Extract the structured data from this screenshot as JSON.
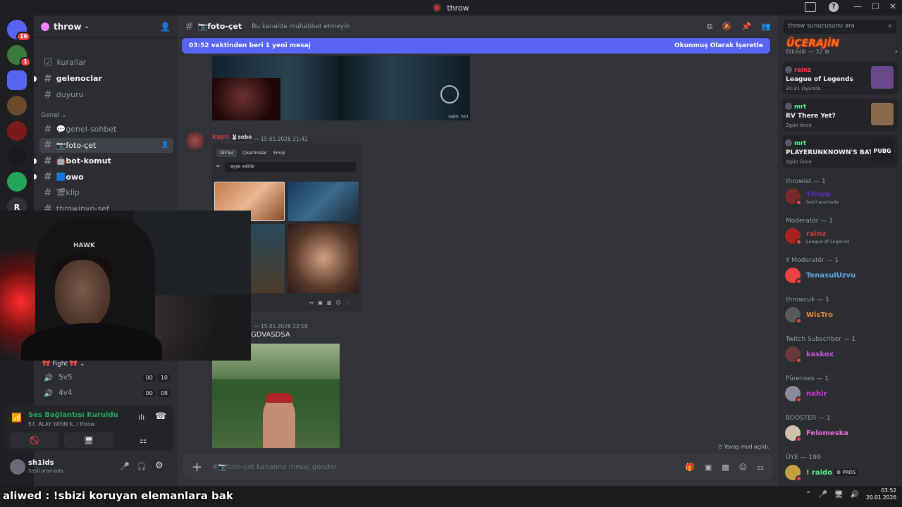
{
  "window": {
    "title": "throw"
  },
  "servers": [
    {
      "label": "",
      "badge": "16",
      "color": "#5865f2"
    },
    {
      "label": "",
      "badge": "1",
      "color": "#3a7a3a"
    },
    {
      "label": "",
      "badge": "",
      "color": "#5865f2"
    },
    {
      "label": "",
      "badge": "",
      "color": "#6a4a2a"
    },
    {
      "label": "",
      "badge": "",
      "color": "#7a1a1a"
    },
    {
      "label": "",
      "badge": "",
      "color": "#1a1a1a"
    },
    {
      "label": "",
      "badge": "",
      "color": "#23a55a"
    },
    {
      "label": "R",
      "badge": "",
      "color": "#313338"
    }
  ],
  "guild": {
    "name": "throw"
  },
  "channels": {
    "top_items": [
      {
        "icon": "",
        "name": "kurallar"
      },
      {
        "icon": "#",
        "name": "gelenoclar"
      },
      {
        "icon": "#",
        "name": "duyuru"
      }
    ],
    "category_genel": "Genel",
    "genel_items": [
      {
        "name": "💬genel-sohbet"
      },
      {
        "name": "📷foto-çet"
      },
      {
        "name": "🤖bot-komut"
      },
      {
        "name": "🟦owo"
      },
      {
        "name": "🎬klip"
      },
      {
        "name": "throwinyo-şef"
      }
    ],
    "category_fight": "Fight",
    "voice_items": [
      {
        "name": "5v5",
        "c1": "00",
        "c2": "10"
      },
      {
        "name": "4v4",
        "c1": "00",
        "c2": "08"
      }
    ]
  },
  "voice_panel": {
    "status": "Ses Bağlantısı Kuruldu",
    "location": "57. ALAY YAYIN K. / throw"
  },
  "user": {
    "name": "sh1lds",
    "status": "Sesli aramada"
  },
  "channel_header": {
    "name": "📷foto-çet",
    "topic": "Bu kanalda muhabbet etmeyin"
  },
  "new_messages_bar": {
    "text": "03:52 vaktinden beri 1 yeni mesaj",
    "action": "Okunmuş Olarak İşaretle"
  },
  "messages": [
    {
      "author": "kayn",
      "tag": "sebo",
      "time": "15.01.2026 21:42"
    },
    {
      "author": "",
      "time": "15.01.2026 22:18",
      "text": "GDVASDSA"
    }
  ],
  "image_caption": "sağlık: %01",
  "gif_panel": {
    "tabs": [
      "GIF'ler",
      "Çıkartmalar",
      "Emoji"
    ],
    "search": "ayşe valide"
  },
  "slowmode": "Yavaş mod açıldı.",
  "composer": {
    "placeholder": "#📷foto-çet kanalına mesaj gönder"
  },
  "members_panel": {
    "search_placeholder": "throw sunucusunu ara",
    "banner": "ÜÇERAJİN",
    "activity_header": "Etkinlik — 32",
    "activity_cards": [
      {
        "user": "rainz",
        "user_color": "#ed4245",
        "title": "League of Legends",
        "sub": "31:31  Oyunda",
        "art_color": "#6a4a8a"
      },
      {
        "user": "mrt",
        "user_color": "#57f287",
        "title": "RV There Yet?",
        "sub": "2gün önce",
        "art_color": "#8a6a4a"
      },
      {
        "user": "mrt",
        "user_color": "#57f287",
        "title": "PLAYERUNKNOWN'S BAT...",
        "sub": "2gün önce",
        "art_color": "#1e1f22",
        "art_label": "PUBG"
      }
    ],
    "groups": [
      {
        "role": "throwist — 1",
        "members": [
          {
            "name": "Throw",
            "sub": "Sesli aramada",
            "color": "#5b2ac0",
            "av": "#7a2a2a"
          }
        ]
      },
      {
        "role": "Moderatör — 1",
        "members": [
          {
            "name": "rainz",
            "sub": "League of Legends",
            "color": "#c23a3a",
            "av": "#a82020"
          }
        ]
      },
      {
        "role": "Y Moderatör — 1",
        "members": [
          {
            "name": "TenasulUzvu",
            "sub": "",
            "color": "#5da8e8",
            "av": "#ed4245"
          }
        ]
      },
      {
        "role": "throwcuk — 1",
        "members": [
          {
            "name": "WisTro",
            "sub": "",
            "color": "#e88a3a",
            "av": "#5a5a5a"
          }
        ]
      },
      {
        "role": "Twitch Subscriber — 1",
        "members": [
          {
            "name": "kaskox",
            "sub": "",
            "color": "#c05ad8",
            "av": "#6a3a3a"
          }
        ]
      },
      {
        "role": "Pürenses — 1",
        "members": [
          {
            "name": "nehir",
            "sub": "",
            "color": "#d63ae0",
            "av": "#8a8a9a"
          }
        ]
      },
      {
        "role": "BOOSTER — 1",
        "members": [
          {
            "name": "Felomeska",
            "sub": "",
            "color": "#e86ad8",
            "av": "#d0c0b0"
          }
        ]
      },
      {
        "role": "ÜYE — 199",
        "members": [
          {
            "name": "! raido",
            "sub": "",
            "color": "#57f287",
            "av": "#c0a040",
            "tag": "PRDS"
          }
        ]
      }
    ]
  },
  "overlay_text": "aliwed : !sbizi koruyan elemanlara bak",
  "clock": {
    "time": "03:52",
    "date": "20.01.2026"
  }
}
